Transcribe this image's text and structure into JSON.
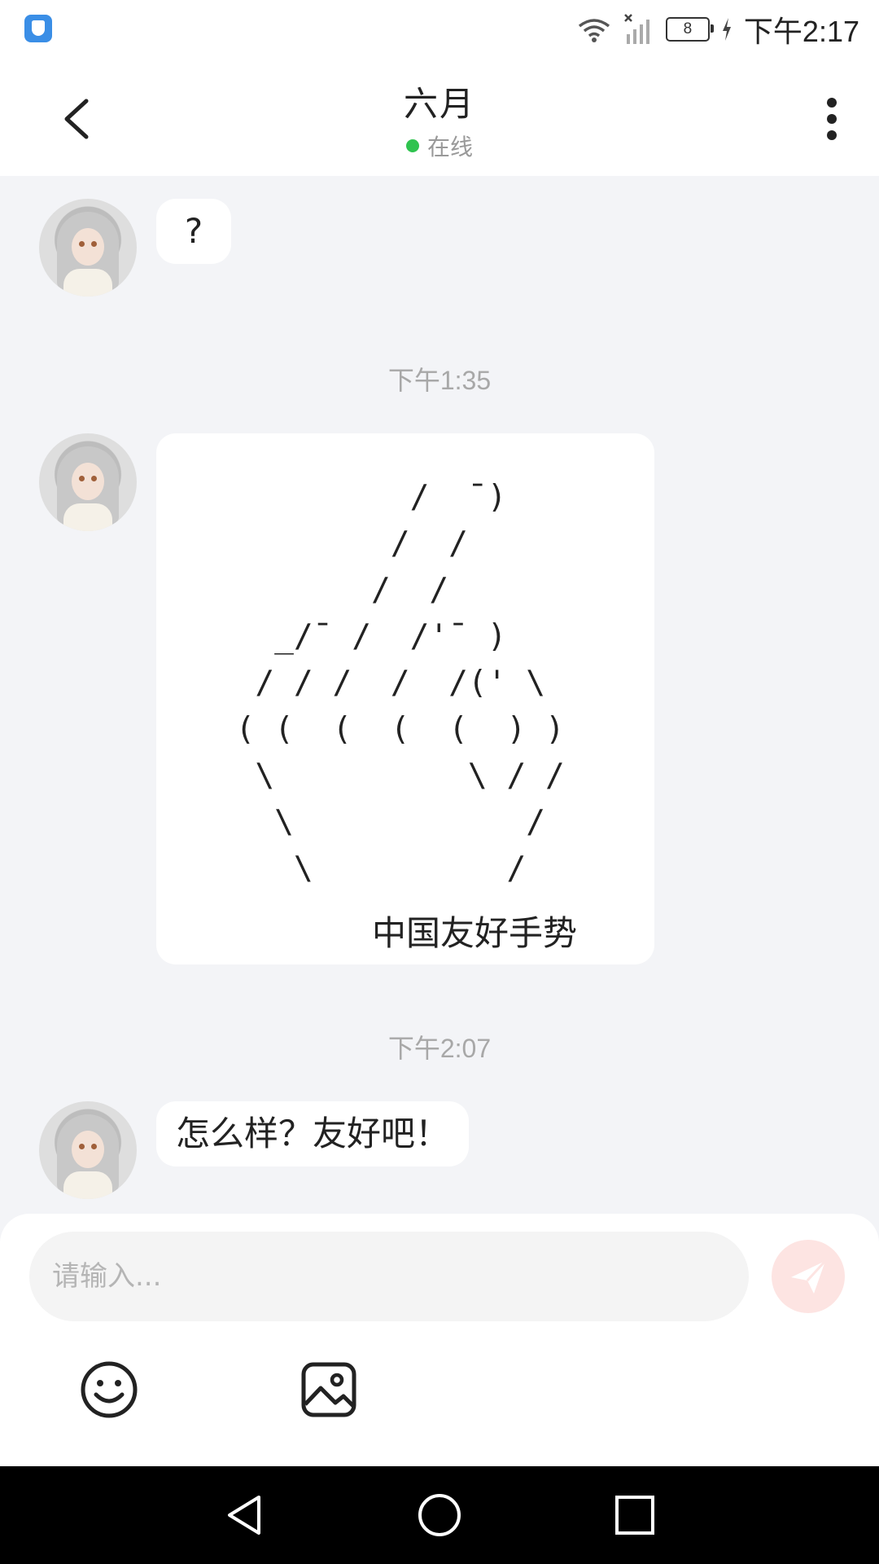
{
  "status_bar": {
    "time": "下午2:17",
    "battery_level": "8",
    "icons": [
      "shield-app-icon",
      "wifi-icon",
      "signal-off-icon",
      "battery-icon",
      "charging-icon"
    ]
  },
  "header": {
    "title": "六月",
    "status": "在线",
    "status_color": "#2fc34f",
    "icons": [
      "back-arrow-icon",
      "more-vertical-icon"
    ]
  },
  "messages": [
    {
      "type": "text",
      "text": "?"
    },
    {
      "type": "timestamp",
      "text": "下午1:35"
    },
    {
      "type": "ascii-art",
      "ascii_lines": [
        "           /  ¯)",
        "          /  /",
        "         /  /",
        "    _/¯ /  /'¯ )",
        "   / / /  /  /(' \\",
        "  ( (  (  (  (  ) )",
        "   \\          \\ / /",
        "    \\            /",
        "     \\          /"
      ],
      "caption": "中国友好手势"
    },
    {
      "type": "timestamp",
      "text": "下午2:07"
    },
    {
      "type": "text",
      "text": "怎么样？友好吧！"
    }
  ],
  "input": {
    "placeholder": "请输入...",
    "value": ""
  },
  "toolbar": {
    "icons": [
      "emoji-icon",
      "image-icon",
      "send-icon"
    ]
  },
  "colors": {
    "chat_background": "#f3f4f7",
    "bubble": "#ffffff",
    "send_button": "#fde4e2",
    "send_icon": "#ffffff"
  },
  "nav_bar": {
    "icons": [
      "back-triangle-icon",
      "home-circle-icon",
      "recents-square-icon"
    ]
  }
}
